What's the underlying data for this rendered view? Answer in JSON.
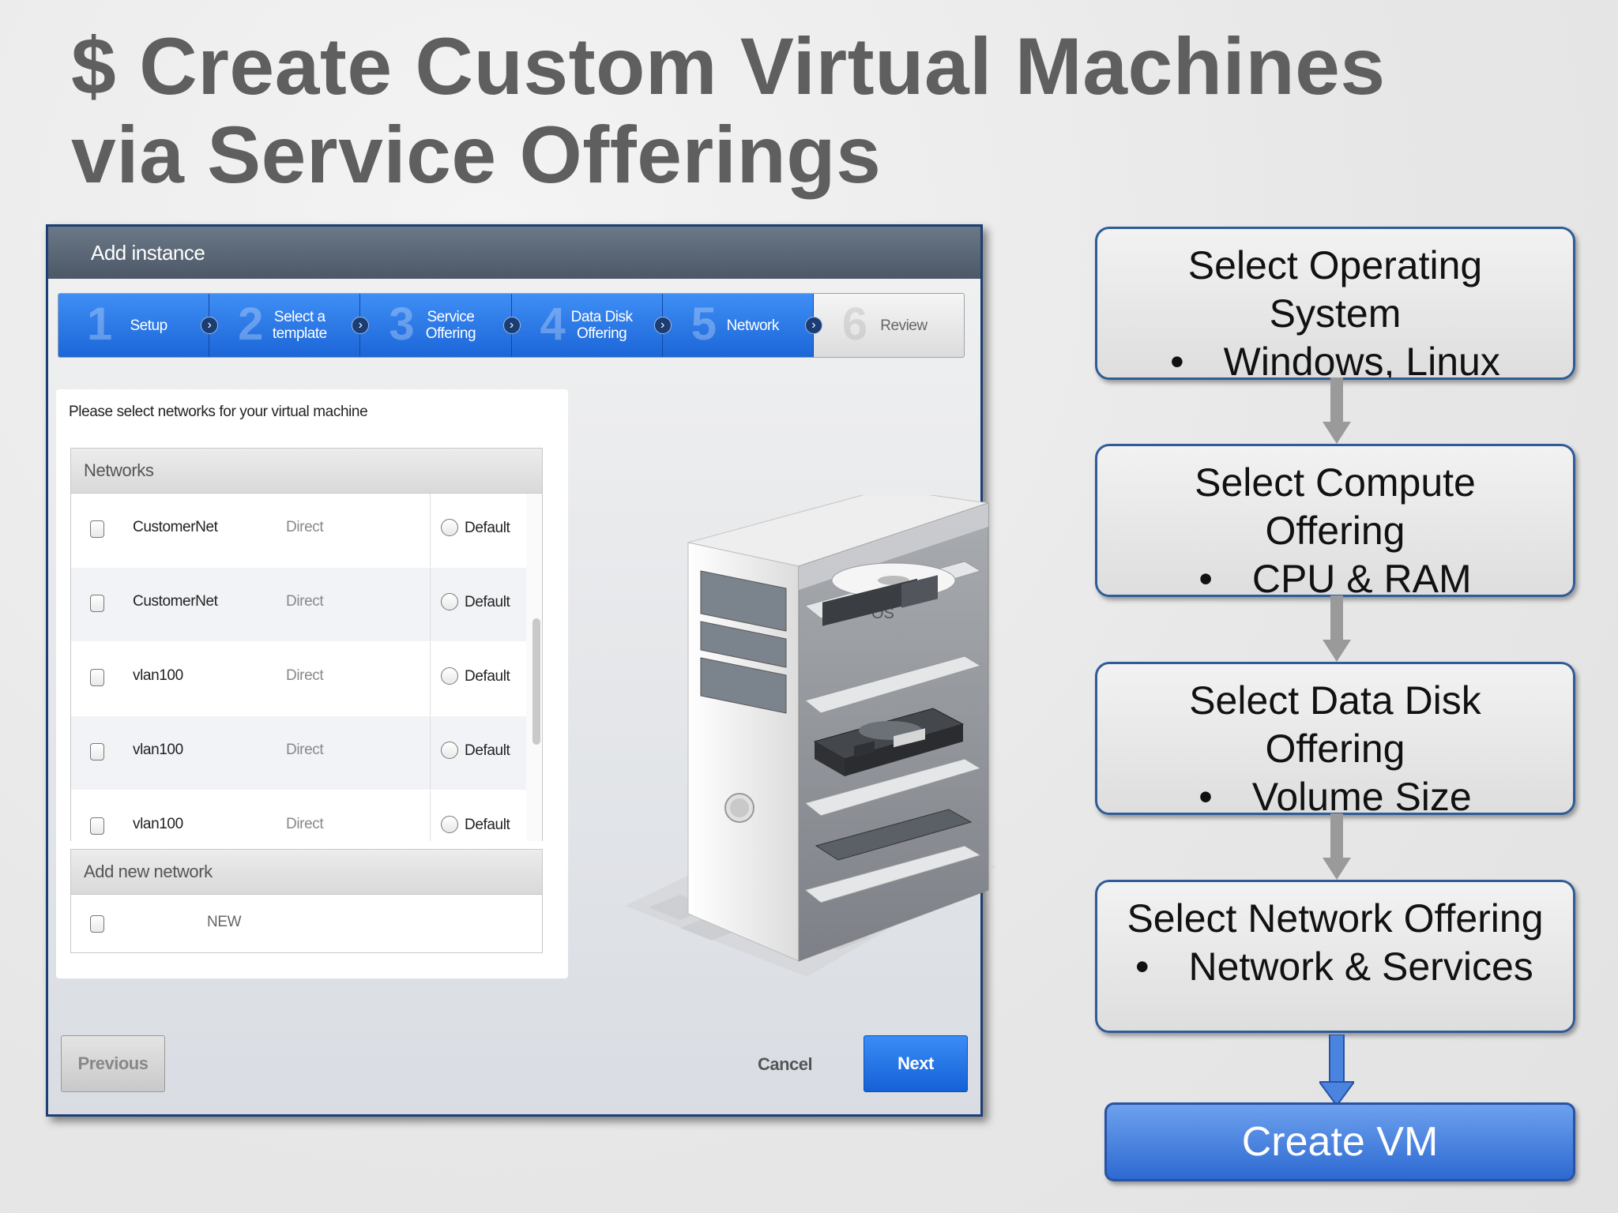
{
  "slide": {
    "title_line1": "$ Create Custom Virtual Machines",
    "title_line2": "via Service Offerings"
  },
  "dialog": {
    "title": "Add instance",
    "steps": [
      {
        "num": "1",
        "label": "Setup"
      },
      {
        "num": "2",
        "label": "Select a template"
      },
      {
        "num": "3",
        "label": "Service Offering"
      },
      {
        "num": "4",
        "label": "Data Disk Offering"
      },
      {
        "num": "5",
        "label": "Network"
      },
      {
        "num": "6",
        "label": "Review"
      }
    ],
    "instruction": "Please select networks for your virtual machine",
    "networks_header": "Networks",
    "networks": [
      {
        "name": "CustomerNet",
        "type": "Direct",
        "default_label": "Default"
      },
      {
        "name": "CustomerNet",
        "type": "Direct",
        "default_label": "Default"
      },
      {
        "name": "vlan100",
        "type": "Direct",
        "default_label": "Default"
      },
      {
        "name": "vlan100",
        "type": "Direct",
        "default_label": "Default"
      },
      {
        "name": "vlan100",
        "type": "Direct",
        "default_label": "Default"
      }
    ],
    "add_network_header": "Add new network",
    "new_label": "NEW",
    "server_os_label": "OS",
    "previous_label": "Previous",
    "cancel_label": "Cancel",
    "next_label": "Next"
  },
  "flow": {
    "boxes": [
      {
        "lines": [
          "Select Operating",
          "System"
        ],
        "bullet": "Windows, Linux"
      },
      {
        "lines": [
          "Select Compute",
          "Offering"
        ],
        "bullet": "CPU & RAM"
      },
      {
        "lines": [
          "Select Data Disk",
          "Offering"
        ],
        "bullet": "Volume Size"
      },
      {
        "lines": [
          "Select Network Offering"
        ],
        "bullet": "Network & Services"
      }
    ],
    "create_label": "Create VM"
  },
  "colors": {
    "step_active": "#2b78e8",
    "dialog_border": "#1d3f73",
    "flow_border": "#2f5c98",
    "create_button": "#4a84df"
  }
}
